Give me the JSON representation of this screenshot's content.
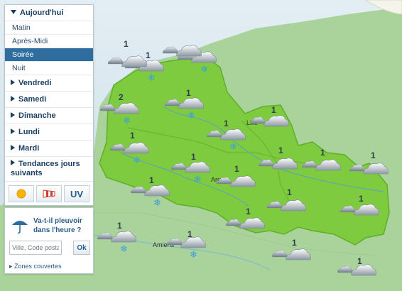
{
  "sidebar": {
    "days": [
      {
        "label": "Aujourd'hui",
        "open": true
      },
      {
        "label": "Vendredi"
      },
      {
        "label": "Samedi"
      },
      {
        "label": "Dimanche"
      },
      {
        "label": "Lundi"
      },
      {
        "label": "Mardi"
      },
      {
        "label": "Tendances jours suivants"
      }
    ],
    "periods": [
      "Matin",
      "Après-Midi",
      "Soirée",
      "Nuit"
    ],
    "active_period": "Soirée",
    "toggles": {
      "sun_icon": "sun-icon",
      "wind_icon": "windsock-icon",
      "uv_label": "UV"
    }
  },
  "rain": {
    "title": "Va-t-il pleuvoir dans l'heure ?",
    "placeholder": "Ville, Code postal",
    "ok_label": "Ok",
    "zones_link": "Zones couvertes"
  },
  "map": {
    "cities": [
      "Lille",
      "Arras",
      "Amiens"
    ],
    "forecasts": [
      {
        "value": "1",
        "icon": "snow-cloud-icon"
      },
      {
        "value": "1",
        "icon": "snow-cloud-icon"
      },
      {
        "value": "2",
        "icon": "snow-cloud-icon"
      },
      {
        "value": "1",
        "icon": "snow-cloud-icon"
      },
      {
        "value": "1",
        "icon": "snow-cloud-icon"
      },
      {
        "value": "1",
        "icon": "snow-cloud-icon"
      },
      {
        "value": "1",
        "icon": "snow-cloud-icon"
      },
      {
        "value": "1",
        "icon": "snow-cloud-icon"
      },
      {
        "value": "1",
        "icon": "snow-cloud-icon"
      },
      {
        "value": "1",
        "icon": "snow-cloud-icon"
      },
      {
        "value": "1",
        "icon": "cloud-icon"
      },
      {
        "value": "1",
        "icon": "cloud-icon"
      },
      {
        "value": "1",
        "icon": "cloud-icon"
      },
      {
        "value": "1",
        "icon": "cloud-icon"
      },
      {
        "value": "1",
        "icon": "cloud-icon"
      },
      {
        "value": "1",
        "icon": "cloud-icon"
      },
      {
        "value": "1",
        "icon": "cloud-icon"
      },
      {
        "value": "1",
        "icon": "cloud-icon"
      },
      {
        "value": "1",
        "icon": "cloud-icon"
      },
      {
        "value": "1",
        "icon": "cloud-icon"
      },
      {
        "value": "2",
        "icon": "cloud-icon"
      },
      {
        "value": "1",
        "icon": "cloud-icon"
      }
    ],
    "colors": {
      "sea": "#d4e4ee",
      "land": "#7ecb3f",
      "outside": "#a8d19a",
      "accent": "#2e6d9e"
    }
  }
}
